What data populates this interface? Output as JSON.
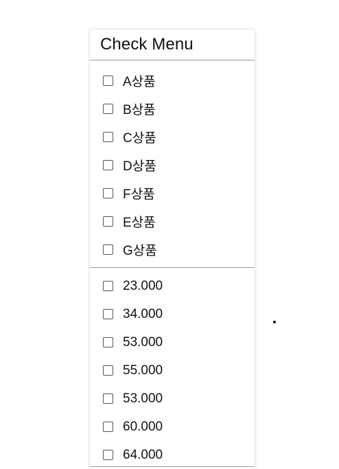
{
  "menu": {
    "title": "Check Menu",
    "products": [
      {
        "label": "A상품",
        "checked": false
      },
      {
        "label": "B상품",
        "checked": false
      },
      {
        "label": "C상품",
        "checked": false
      },
      {
        "label": "D상품",
        "checked": false
      },
      {
        "label": "F상품",
        "checked": false
      },
      {
        "label": "E상품",
        "checked": false
      },
      {
        "label": "G상품",
        "checked": false
      }
    ],
    "prices": [
      {
        "label": "23.000",
        "checked": false
      },
      {
        "label": "34.000",
        "checked": false
      },
      {
        "label": "53.000",
        "checked": false
      },
      {
        "label": "55.000",
        "checked": false
      },
      {
        "label": "53.000",
        "checked": false
      },
      {
        "label": "60.000",
        "checked": false
      },
      {
        "label": "64.000",
        "checked": false
      }
    ]
  }
}
